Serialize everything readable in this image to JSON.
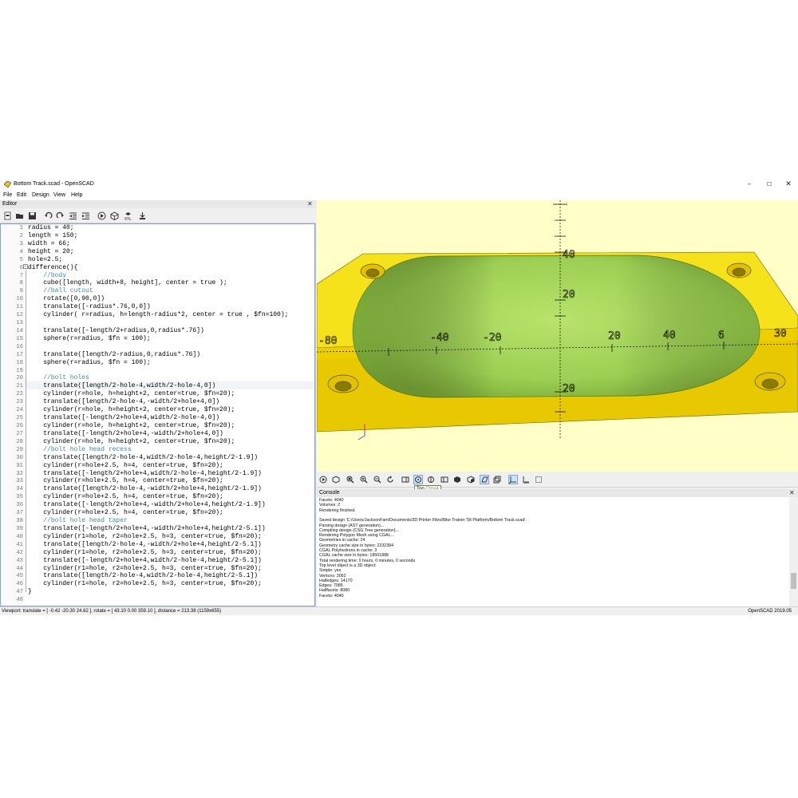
{
  "window": {
    "title": "Bottom Track.scad - OpenSCAD",
    "controls": [
      "–",
      "☐",
      "✕"
    ]
  },
  "menu": [
    "File",
    "Edit",
    "Design",
    "View",
    "Help"
  ],
  "editor": {
    "title": "Editor",
    "close": "✕",
    "lines": [
      "radius = 40;",
      "length = 150;",
      "width = 66;",
      "height = 20;",
      "hole=2.5;",
      "difference(){",
      "    //body",
      "    cube([length, width+8, height], center = true );",
      "    //ball cutout",
      "    rotate([0,90,0])",
      "    translate([-radius*.76,0,0])",
      "    cylinder( r=radius, h=length-radius*2, center = true , $fn=100);",
      "",
      "    translate([-length/2+radius,0,radius*.76])",
      "    sphere(r=radius, $fn = 100);",
      "",
      "    translate([length/2-radius,0,radius*.76])",
      "    sphere(r=radius, $fn = 100);",
      "",
      "    //bolt holes",
      "    translate([length/2-hole-4,width/2-hole-4,0])",
      "    cylinder(r=hole, h=height+2, center=true, $fn=20);",
      "    translate([length/2-hole-4,-width/2+hole+4,0])",
      "    cylinder(r=hole, h=height+2, center=true, $fn=20);",
      "    translate([-length/2+hole+4,width/2-hole-4,0])",
      "    cylinder(r=hole, h=height+2, center=true, $fn=20);",
      "    translate([-length/2+hole+4,-width/2+hole+4,0])",
      "    cylinder(r=hole, h=height+2, center=true, $fn=20);",
      "    //bolt hole head recess",
      "    translate([length/2-hole-4,width/2-hole-4,height/2-1.9])",
      "    cylinder(r=hole+2.5, h=4, center=true, $fn=20);",
      "    translate([-length/2+hole+4,width/2-hole-4,height/2-1.9])",
      "    cylinder(r=hole+2.5, h=4, center=true, $fn=20);",
      "    translate([length/2-hole-4,-width/2+hole+4,height/2-1.9])",
      "    cylinder(r=hole+2.5, h=4, center=true, $fn=20);",
      "    translate([-length/2+hole+4,-width/2+hole+4,height/2-1.9])",
      "    cylinder(r=hole+2.5, h=4, center=true, $fn=20);",
      "    //bolt hole head taper",
      "    translate([-length/2+hole+4,-width/2+hole+4,height/2-5.1])",
      "    cylinder(r1=hole, r2=hole+2.5, h=3, center=true, $fn=20);",
      "    translate([length/2-hole-4,-width/2+hole+4,height/2-5.1])",
      "    cylinder(r1=hole, r2=hole+2.5, h=3, center=true, $fn=20);",
      "    translate([-length/2+hole+4,width/2-hole-4,height/2-5.1])",
      "    cylinder(r1=hole, r2=hole+2.5, h=3, center=true, $fn=20);",
      "    translate([length/2-hole-4,width/2-hole-4,height/2-5.1])",
      "    cylinder(r1=hole, r2=hole+2.5, h=3, center=true, $fn=20);",
      "}",
      ""
    ],
    "comment_lines": [
      7,
      9,
      20,
      29,
      38
    ]
  },
  "viewport": {
    "axis_labels": [
      "-80",
      "-40",
      "-20",
      "20",
      "40",
      "6",
      "30",
      "20",
      "20",
      "40"
    ],
    "colors": {
      "background": "#ffffc7",
      "model_yellow": "#f5e21a",
      "cavity_green": "#9fd454",
      "axes": "#000000"
    }
  },
  "viewer_toolbar": {
    "tooltip": "Top",
    "tooltip_shortcut": "Ctrl+4"
  },
  "console": {
    "title": "Console",
    "close": "✕",
    "lines": [
      "Facets: 4040",
      "Volumes: 2",
      "Rendering finished.",
      "",
      "Saved design 'C:/Users/JacksonFam/Documents/3D Printer Files/Bike Trainer Tilt Platform/Bottom Track.scad'.",
      "Parsing design (AST generation)...",
      "Compiling design (CSG Tree generation)...",
      "Rendering Polygon Mesh using CGAL...",
      "Geometries in cache: 24",
      "Geometry cache size in bytes: 2232384",
      "CGAL Polyhedrons in cache: 3",
      "CGAL cache size in bytes: 18501888",
      "Total rendering time: 0 hours, 0 minutes, 0 seconds",
      "Top level object is a 3D object:",
      "Simple: yes",
      "Vertices: 3052",
      "Halfedges: 14170",
      "Edges: 7085",
      "Halffacets: 8080",
      "Facets: 4040"
    ]
  },
  "statusbar": {
    "viewport_info": "Viewport: translate = [ -0.42 -20.30 24.82 ], rotate = [ 43.10 0.00 359.10 ], distance = 213.38 (1159x655)",
    "version": "OpenSCAD 2019.05"
  }
}
